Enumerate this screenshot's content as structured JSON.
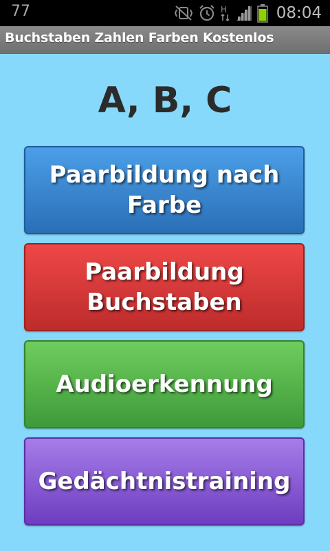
{
  "status_bar": {
    "notification_count": "77",
    "time": "08:04",
    "network_label": "H",
    "icons": [
      "vibrate-silent-icon",
      "alarm-icon",
      "network-h-icon",
      "signal-icon",
      "battery-icon"
    ],
    "battery_color": "#8ed000"
  },
  "app": {
    "title": "Buchstaben Zahlen Farben Kostenlos"
  },
  "main": {
    "heading": "A, B, C",
    "buttons": [
      {
        "label": "Paarbildung nach Farbe",
        "color": "#3b86d6"
      },
      {
        "label": "Paarbildung Buchstaben",
        "color": "#dc3b3b"
      },
      {
        "label": "Audioerkennung",
        "color": "#57b54a"
      },
      {
        "label": "Gedächtnistraining",
        "color": "#8a5ad6"
      }
    ]
  },
  "colors": {
    "background": "#87d9fb",
    "heading_text": "#2b2b2b"
  }
}
